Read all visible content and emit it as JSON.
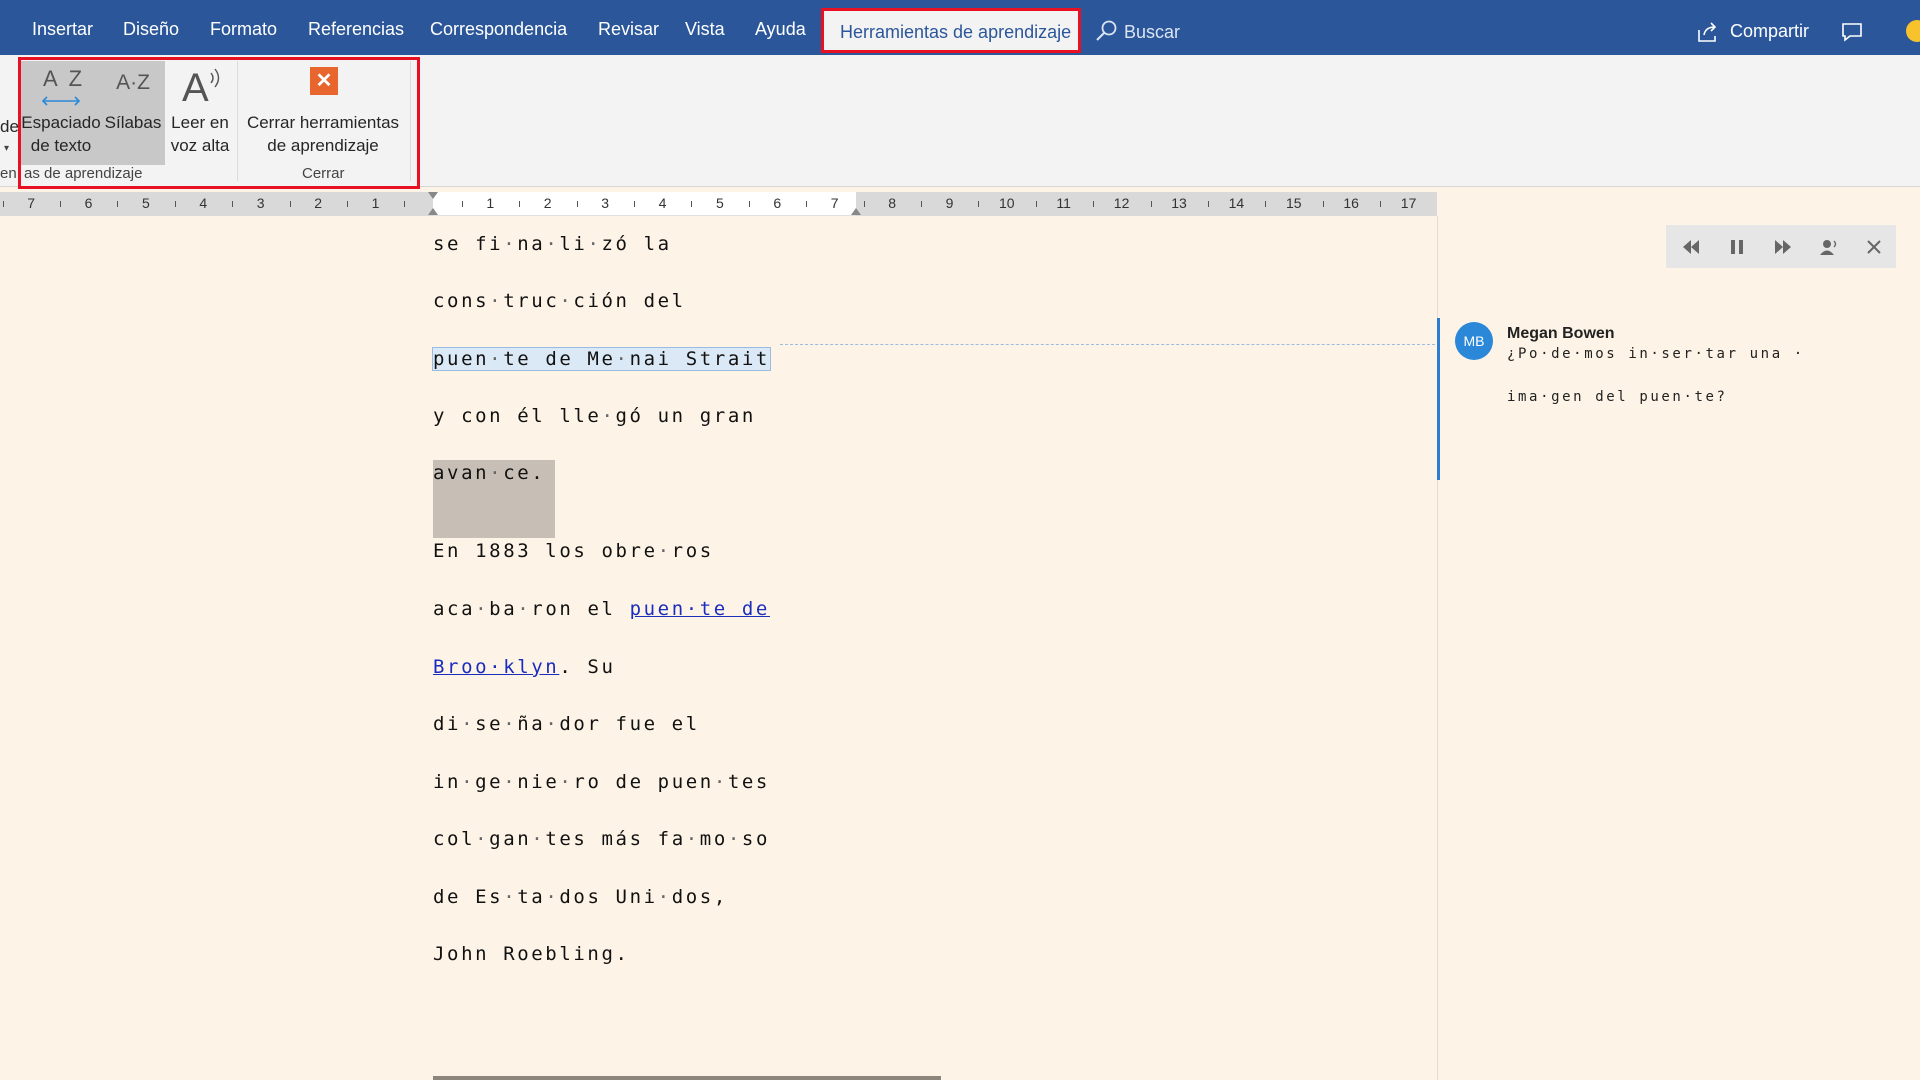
{
  "tabs": {
    "items": [
      "Insertar",
      "Diseño",
      "Formato",
      "Referencias",
      "Correspondencia",
      "Revisar",
      "Vista",
      "Ayuda"
    ],
    "active": "Herramientas de aprendizaje",
    "search": "Buscar",
    "share": "Compartir"
  },
  "ribbon": {
    "partial_left_button": "de",
    "partial_group_label": "en",
    "learning_group_label": "as de aprendizaje",
    "close_group_label": "Cerrar",
    "buttons": {
      "text_spacing": {
        "line1": "Espaciado",
        "line2": "de texto",
        "icon_text": "A Z"
      },
      "syllables": {
        "line1": "Sílabas",
        "icon_text": "A·Z"
      },
      "read_aloud": {
        "line1": "Leer en",
        "line2": "voz alta",
        "icon_text": "A"
      },
      "close_tools": {
        "line1": "Cerrar herramientas",
        "line2": "de aprendizaje",
        "icon_text": "✕"
      }
    }
  },
  "ruler": {
    "left_numbers": [
      "7",
      "6",
      "5",
      "4",
      "3",
      "2",
      "1"
    ],
    "right_numbers": [
      "1",
      "2",
      "3",
      "4",
      "5",
      "6",
      "7",
      "8",
      "9",
      "10",
      "11",
      "12",
      "13",
      "14",
      "15",
      "16",
      "17"
    ]
  },
  "document": {
    "lines": [
      [
        {
          "t": "se fi"
        },
        {
          "t": "·",
          "d": 1
        },
        {
          "t": "na"
        },
        {
          "t": "·",
          "d": 1
        },
        {
          "t": "li"
        },
        {
          "t": "·",
          "d": 1
        },
        {
          "t": "zó la"
        }
      ],
      [
        {
          "t": "cons"
        },
        {
          "t": "·",
          "d": 1
        },
        {
          "t": "truc"
        },
        {
          "t": "·",
          "d": 1
        },
        {
          "t": "ción del"
        }
      ],
      [
        {
          "t": "puen"
        },
        {
          "t": "·",
          "d": 1
        },
        {
          "t": "te de Me"
        },
        {
          "t": "·",
          "d": 1
        },
        {
          "t": "nai Strait"
        }
      ],
      [
        {
          "t": "y con él lle"
        },
        {
          "t": "·",
          "d": 1
        },
        {
          "t": "gó un gran"
        }
      ],
      [
        {
          "t": "avan"
        },
        {
          "t": "·",
          "d": 1
        },
        {
          "t": "ce."
        }
      ],
      [
        {
          "t": "En 1883 los obre"
        },
        {
          "t": "·",
          "d": 1
        },
        {
          "t": "ros"
        }
      ],
      [
        {
          "t": "aca"
        },
        {
          "t": "·",
          "d": 1
        },
        {
          "t": "ba"
        },
        {
          "t": "·",
          "d": 1
        },
        {
          "t": "ron el "
        },
        {
          "t": "puen·te de",
          "l": 1
        }
      ],
      [
        {
          "t": "Broo·klyn",
          "l": 1
        },
        {
          "t": ". Su"
        }
      ],
      [
        {
          "t": "di"
        },
        {
          "t": "·",
          "d": 1
        },
        {
          "t": "se"
        },
        {
          "t": "·",
          "d": 1
        },
        {
          "t": "ña"
        },
        {
          "t": "·",
          "d": 1
        },
        {
          "t": "dor fue el"
        }
      ],
      [
        {
          "t": "in"
        },
        {
          "t": "·",
          "d": 1
        },
        {
          "t": "ge"
        },
        {
          "t": "·",
          "d": 1
        },
        {
          "t": "nie"
        },
        {
          "t": "·",
          "d": 1
        },
        {
          "t": "ro de puen"
        },
        {
          "t": "·",
          "d": 1
        },
        {
          "t": "tes"
        }
      ],
      [
        {
          "t": "col"
        },
        {
          "t": "·",
          "d": 1
        },
        {
          "t": "gan"
        },
        {
          "t": "·",
          "d": 1
        },
        {
          "t": "tes más fa"
        },
        {
          "t": "·",
          "d": 1
        },
        {
          "t": "mo"
        },
        {
          "t": "·",
          "d": 1
        },
        {
          "t": "so"
        }
      ],
      [
        {
          "t": "de Es"
        },
        {
          "t": "·",
          "d": 1
        },
        {
          "t": "ta"
        },
        {
          "t": "·",
          "d": 1
        },
        {
          "t": "dos Uni"
        },
        {
          "t": "·",
          "d": 1
        },
        {
          "t": "dos,"
        }
      ],
      [
        {
          "t": "John Roebling."
        }
      ]
    ]
  },
  "comment": {
    "initials": "MB",
    "author": "Megan Bowen",
    "line1": "¿Po·de·mos in·ser·tar una ·",
    "line2": "ima·gen del puen·te?"
  },
  "colors": {
    "accent": "#2b579a",
    "highlight_border": "#e81123",
    "close_icon": "#e8652e",
    "link": "#1a2dbd",
    "page_background": "#fdf4e7"
  }
}
